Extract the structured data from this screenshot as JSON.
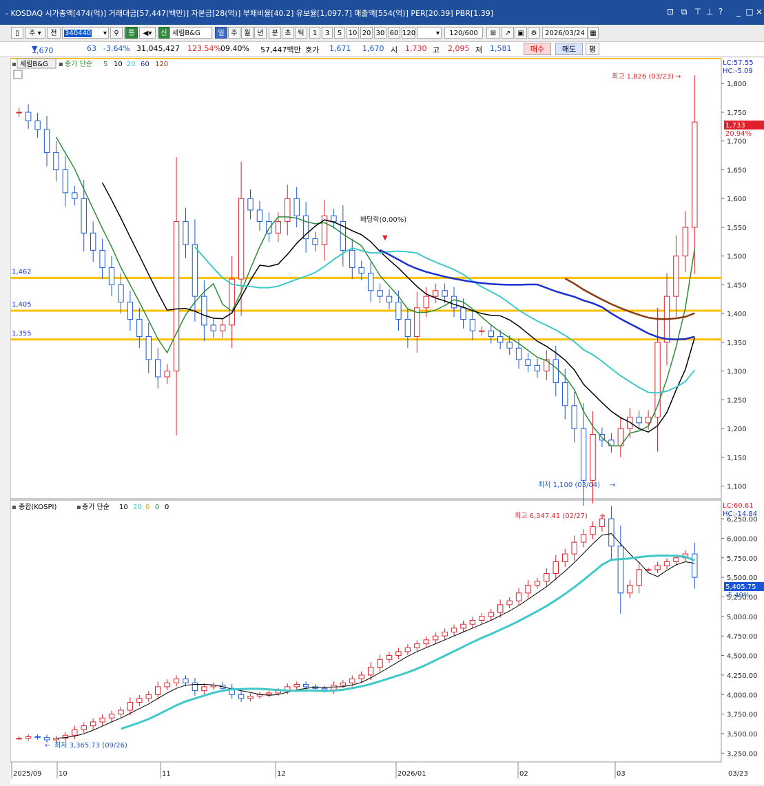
{
  "window": {
    "title": "- KOSDAQ 시가총액[474(억)] 거래대금[57,447(백만)] 자본금[28(억)] 부채비율[40.2] 유보율[1,097.7] 매출액[554(억)] PER[20.39] PBR[1.39]"
  },
  "toolbar": {
    "market": "주",
    "range_label": "전",
    "code": "340440",
    "badge_tong": "통",
    "badge_sin": "신",
    "stock_name": "세림B&G",
    "periods": [
      "일",
      "주",
      "월",
      "년",
      "분",
      "초",
      "틱"
    ],
    "minutes": [
      "1",
      "3",
      "5",
      "10",
      "20",
      "30",
      "60",
      "120"
    ],
    "count": "120/600",
    "date": "2026/03/24"
  },
  "quote": {
    "price": "1,670",
    "change": "63",
    "change_pct": "-3.64%",
    "volume": "31,045,427",
    "vol_ratio": "123.54%",
    "turnover": "09.40%",
    "amount": "57,447백만",
    "ask_label": "호가",
    "ask": "1,671",
    "bid": "1,670",
    "open_label": "시",
    "open": "1,730",
    "high_label": "고",
    "high": "2,095",
    "low_label": "저",
    "low": "1,581",
    "buy": "매수",
    "sell": "매도",
    "eval": "평"
  },
  "main_chart": {
    "name": "세림B&G",
    "legend_label": "종가 단순",
    "ma_periods": [
      "5",
      "10",
      "20",
      "60",
      "120"
    ],
    "lc": "LC:57.55",
    "hc": "HC:-5.09",
    "last_price": "1,733",
    "last_pct": "20.94%",
    "high_note": "최고 1,826 (03/23)",
    "low_note": "최저 1,100 (03/04)",
    "event_note": "배당락(0.00%)",
    "levels": [
      "1,462",
      "1,405",
      "1,355"
    ],
    "yticks": [
      "1,800",
      "1,750",
      "1,700",
      "1,650",
      "1,600",
      "1,550",
      "1,500",
      "1,450",
      "1,400",
      "1,350",
      "1,300",
      "1,250",
      "1,200",
      "1,150",
      "1,100"
    ]
  },
  "kospi_chart": {
    "name": "종합(KOSPI)",
    "legend_label": "종가 단순",
    "ma_periods": [
      "10",
      "20",
      "0",
      "0",
      "0"
    ],
    "lc": "LC:60.61",
    "hc": "HC:-14.84",
    "last_price": "5,405.75",
    "last_pct": "-5.49%",
    "high_note": "최고 6,347.41 (02/27)",
    "low_note": "최저 3,365.73 (09/26)",
    "yticks": [
      "6,250.00",
      "6,000.00",
      "5,750.00",
      "5,500.00",
      "5,250.00",
      "5,000.00",
      "4,750.00",
      "4,500.00",
      "4,250.00",
      "4,000.00",
      "3,750.00",
      "3,500.00",
      "3,250.00"
    ]
  },
  "xaxis": {
    "labels": [
      "2025/09",
      "10",
      "11",
      "12",
      "2026/01",
      "02",
      "03",
      "03/23"
    ]
  },
  "colors": {
    "up": "#e0202a",
    "down": "#1a56d6",
    "ma5": "#2e8b3a",
    "ma10": "#000000",
    "ma20": "#40c8c8",
    "ma60": "#1a2fd0",
    "ma120": "#8b3a10",
    "level": "#ffc000",
    "kospi_ma10": "#000000",
    "kospi_ma20": "#40c8c8"
  },
  "chart_data": [
    {
      "type": "candlestick",
      "title": "세림B&G",
      "ylim": [
        1090,
        1835
      ],
      "x": [
        "2025/09",
        "10",
        "11",
        "12",
        "2026/01",
        "02",
        "03",
        "03/23"
      ],
      "key_levels": [
        1462,
        1405,
        1355
      ],
      "high": {
        "value": 1826,
        "date": "03/23"
      },
      "low": {
        "value": 1100,
        "date": "03/04"
      },
      "last": 1733,
      "closes_approx": [
        1750,
        1735,
        1720,
        1680,
        1650,
        1610,
        1600,
        1540,
        1510,
        1480,
        1450,
        1420,
        1390,
        1360,
        1320,
        1290,
        1300,
        1560,
        1520,
        1430,
        1380,
        1370,
        1380,
        1460,
        1600,
        1580,
        1560,
        1540,
        1560,
        1600,
        1570,
        1530,
        1520,
        1570,
        1560,
        1510,
        1480,
        1470,
        1440,
        1430,
        1420,
        1390,
        1360,
        1410,
        1430,
        1440,
        1430,
        1410,
        1390,
        1370,
        1370,
        1360,
        1350,
        1340,
        1320,
        1310,
        1300,
        1320,
        1280,
        1240,
        1200,
        1110,
        1190,
        1180,
        1170,
        1200,
        1220,
        1210,
        1220,
        1350,
        1430,
        1500,
        1550,
        1733
      ]
    },
    {
      "type": "candlestick",
      "title": "종합(KOSPI)",
      "ylim": [
        3200,
        6330
      ],
      "x": [
        "2025/09",
        "10",
        "11",
        "12",
        "2026/01",
        "02",
        "03",
        "03/23"
      ],
      "high": {
        "value": 6347.41,
        "date": "02/27"
      },
      "low": {
        "value": 3365.73,
        "date": "09/26"
      },
      "last": 5405.75,
      "last_pct": -5.49,
      "closes_approx": [
        3440,
        3460,
        3450,
        3420,
        3440,
        3480,
        3550,
        3600,
        3650,
        3700,
        3750,
        3800,
        3900,
        3950,
        4000,
        4100,
        4150,
        4200,
        4150,
        4050,
        4100,
        4120,
        4080,
        4000,
        3950,
        3980,
        4000,
        4020,
        4050,
        4100,
        4130,
        4100,
        4080,
        4060,
        4120,
        4150,
        4200,
        4250,
        4350,
        4450,
        4500,
        4550,
        4600,
        4650,
        4700,
        4750,
        4800,
        4850,
        4900,
        4950,
        5000,
        5050,
        5150,
        5200,
        5300,
        5400,
        5450,
        5550,
        5700,
        5800,
        5950,
        6050,
        6150,
        6250,
        5900,
        5300,
        5400,
        5600,
        5600,
        5650,
        5700,
        5750,
        5800,
        5500
      ]
    }
  ]
}
